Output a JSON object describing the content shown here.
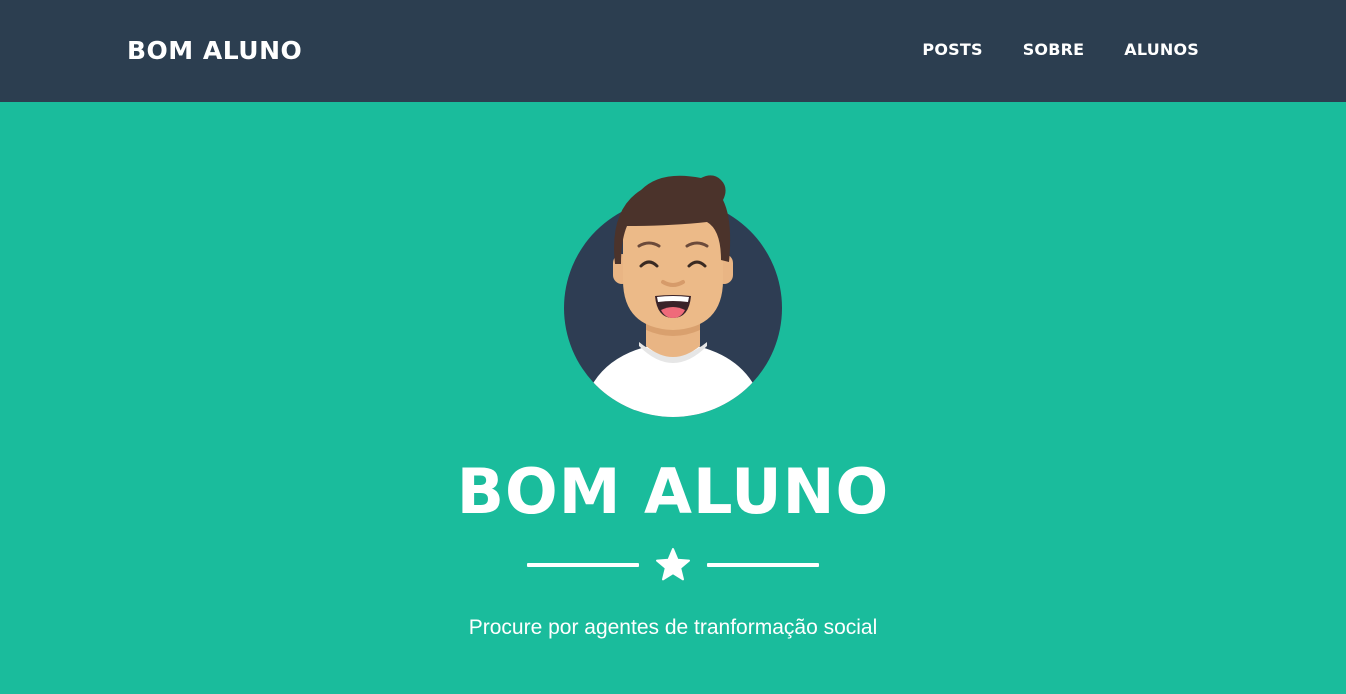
{
  "navbar": {
    "brand": "BOM ALUNO",
    "links": [
      {
        "label": "POSTS"
      },
      {
        "label": "SOBRE"
      },
      {
        "label": "ALUNOS"
      }
    ],
    "background": "#2c3e50"
  },
  "masthead": {
    "avatar_icon": "student-avatar-illustration",
    "title": "BOM ALUNO",
    "divider_icon": "star-icon",
    "subtitle": "Procure por agentes de tranformação social",
    "background": "#1abc9c"
  }
}
